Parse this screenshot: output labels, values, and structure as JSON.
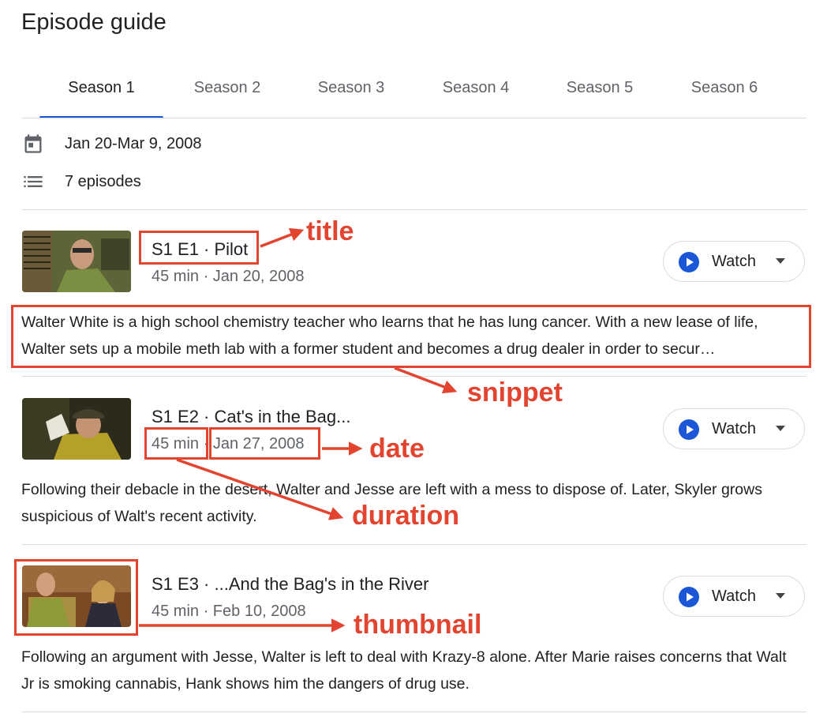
{
  "page": {
    "title": "Episode guide"
  },
  "tabs": [
    {
      "label": "Season 1",
      "active": true
    },
    {
      "label": "Season 2"
    },
    {
      "label": "Season 3"
    },
    {
      "label": "Season 4"
    },
    {
      "label": "Season 5"
    },
    {
      "label": "Season 6"
    }
  ],
  "season_info": {
    "date_range": "Jan 20-Mar 9, 2008",
    "date_icon": "calendar-icon",
    "episode_count": "7 episodes",
    "count_icon": "list-icon"
  },
  "episodes": [
    {
      "title": "S1 E1 · Pilot",
      "meta": "45 min · Jan 20, 2008",
      "snippet": "Walter White is a high school chemistry teacher who learns that he has lung cancer. With a new lease of life, Walter sets up a mobile meth lab with a former student and becomes a drug dealer in order to secur…",
      "watch_label": "Watch"
    },
    {
      "title": "S1 E2 · Cat's in the Bag...",
      "duration": "45 min",
      "meta_sep": "·",
      "date": "Jan 27, 2008",
      "snippet": "Following their debacle in the desert, Walter and Jesse are left with a mess to dispose of. Later, Skyler grows suspicious of Walt's recent activity.",
      "watch_label": "Watch"
    },
    {
      "title": "S1 E3 · ...And the Bag's in the River",
      "meta": "45 min · Feb 10, 2008",
      "snippet": "Following an argument with Jesse, Walter is left to deal with Krazy-8 alone. After Marie raises concerns that Walt Jr is smoking cannabis, Hank shows him the dangers of drug use.",
      "watch_label": "Watch"
    }
  ],
  "annotations": {
    "title": "title",
    "snippet": "snippet",
    "date": "date",
    "duration": "duration",
    "thumbnail": "thumbnail"
  },
  "colors": {
    "accent": "#1a56d6",
    "play": "#1a56d6",
    "annotation": "#e2442f",
    "divider": "#dadce0",
    "secondary_text": "#5f6368"
  }
}
